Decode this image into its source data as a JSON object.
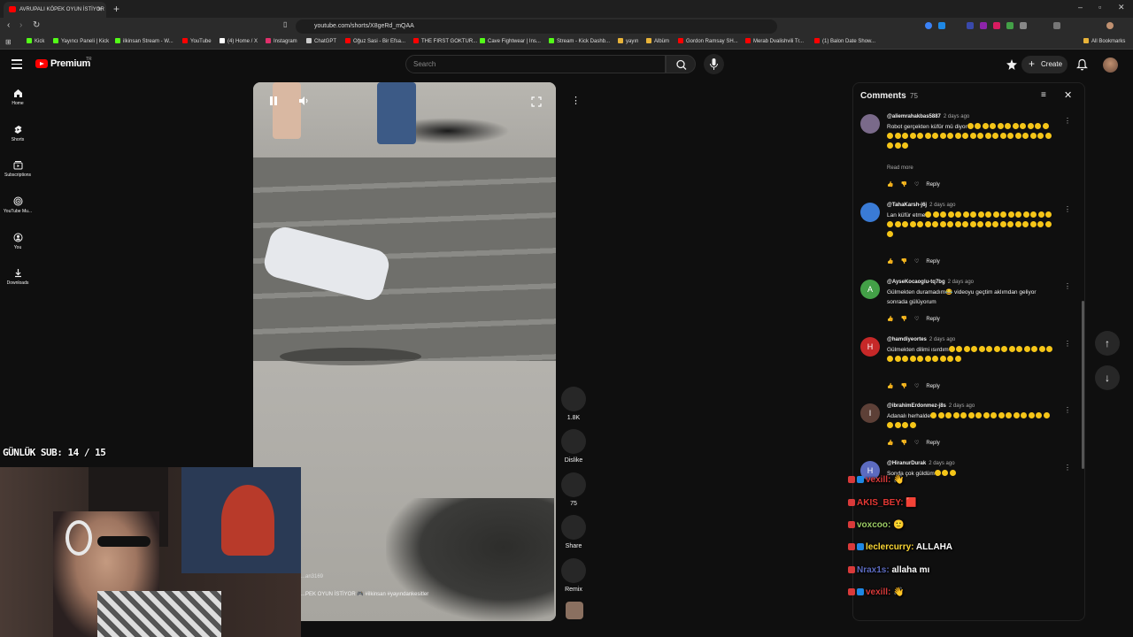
{
  "browser": {
    "tab_title": "AVRUPALI KÖPEK OYUN İSTİYOR",
    "url": "youtube.com/shorts/X8geRd_mQAA",
    "bookmarks": [
      {
        "label": "Kick",
        "color": "#53fc18"
      },
      {
        "label": "Yayıncı Paneli | Kick",
        "color": "#53fc18"
      },
      {
        "label": "ilkinsan Stream - W...",
        "color": "#53fc18"
      },
      {
        "label": "YouTube",
        "color": "#ff0000"
      },
      {
        "label": "(4) Home / X",
        "color": "#ffffff"
      },
      {
        "label": "Instagram",
        "color": "#e1306c"
      },
      {
        "label": "ChatGPT",
        "color": "#cccccc"
      },
      {
        "label": "Oğuz Sasi - Bir Efsa...",
        "color": "#ff0000"
      },
      {
        "label": "THE FIRST GOKTUR...",
        "color": "#ff0000"
      },
      {
        "label": "Cave Fightwear | Ins...",
        "color": "#53fc18"
      },
      {
        "label": "Stream - Kick Dashb...",
        "color": "#53fc18"
      },
      {
        "label": "yayın",
        "color": "#e8b339"
      },
      {
        "label": "Albüm",
        "color": "#e8b339"
      },
      {
        "label": "Gordon Ramsay SH...",
        "color": "#ff0000"
      },
      {
        "label": "Merab Dvalishvili Tr...",
        "color": "#ff0000"
      },
      {
        "label": "(1) Balon Date Show...",
        "color": "#ff0000"
      },
      {
        "label": "All Bookmarks",
        "color": "#e8b339"
      }
    ]
  },
  "header": {
    "logo": "Premium",
    "logo_sup": "TR",
    "search_placeholder": "Search",
    "create_label": "Create"
  },
  "sidebar": [
    {
      "label": "Home",
      "icon": "home-icon"
    },
    {
      "label": "Shorts",
      "icon": "shorts-icon"
    },
    {
      "label": "Subscriptions",
      "icon": "subscriptions-icon"
    },
    {
      "label": "YouTube Mu...",
      "icon": "youtube-music-icon"
    },
    {
      "label": "You",
      "icon": "you-icon"
    },
    {
      "label": "Downloads",
      "icon": "downloads-icon"
    }
  ],
  "short": {
    "likes": "1.8K",
    "dislike_label": "Dislike",
    "comments": "75",
    "share_label": "Share",
    "remix_label": "Remix",
    "channel": "...an3169",
    "caption": "...PEK OYUN İSTİYOR 🎮 #ilkinsan #yayındankesitler"
  },
  "comments_panel": {
    "title": "Comments",
    "count": "75",
    "items": [
      {
        "user": "@aliemrahakbas5887",
        "time": "2 days ago",
        "text": "Robot gerçekten küfür mü diyor",
        "emoji_count": 36,
        "read_more": "Read more",
        "avatar_color": "#7a6a8a",
        "initial": ""
      },
      {
        "user": "@TahaKarsh-j6j",
        "time": "2 days ago",
        "text": "Lan küfür etme",
        "emoji_count": 40,
        "read_more": "",
        "avatar_color": "#3a7bd5",
        "initial": ""
      },
      {
        "user": "@AyseKocaoglu-tq7bg",
        "time": "2 days ago",
        "text": "Gülmekten duramadım😂 videoyu geçtim aklımdan geliyor sonrada gülüyorum",
        "emoji_count": 0,
        "read_more": "",
        "avatar_color": "#43a047",
        "initial": "A"
      },
      {
        "user": "@hamdiyeortes",
        "time": "2 days ago",
        "text": "Gülmekten dilimi ısırdım",
        "emoji_count": 24,
        "read_more": "",
        "avatar_color": "#c62828",
        "initial": "H"
      },
      {
        "user": "@ibrahimErdonmez-j8s",
        "time": "2 days ago",
        "text": "Adanalı herhalde",
        "emoji_count": 20,
        "read_more": "",
        "avatar_color": "#5d4037",
        "initial": "I"
      },
      {
        "user": "@HiranurDurak",
        "time": "2 days ago",
        "text": "Sonda çok güldüm",
        "emoji_count": 3,
        "read_more": "",
        "avatar_color": "#5c6bc0",
        "initial": "H"
      }
    ],
    "reply_label": "Reply"
  },
  "overlay": {
    "sub_counter": "GÜNLÜK SUB: 14 / 15",
    "chat": [
      {
        "user": "vexill:",
        "msg": "👋",
        "color": "#d93a3a"
      },
      {
        "user": "AKIS_BEY:",
        "msg": "🟥",
        "color": "#e53935"
      },
      {
        "user": "voxcoo:",
        "msg": "🙂",
        "color": "#9ccc65"
      },
      {
        "user": "leclercurry:",
        "msg": "ALLAHA",
        "color": "#fdd835"
      },
      {
        "user": "Nrax1s:",
        "msg": "allaha mı",
        "color": "#5c6bc0"
      },
      {
        "user": "vexill:",
        "msg": "👋",
        "color": "#d93a3a"
      }
    ]
  }
}
